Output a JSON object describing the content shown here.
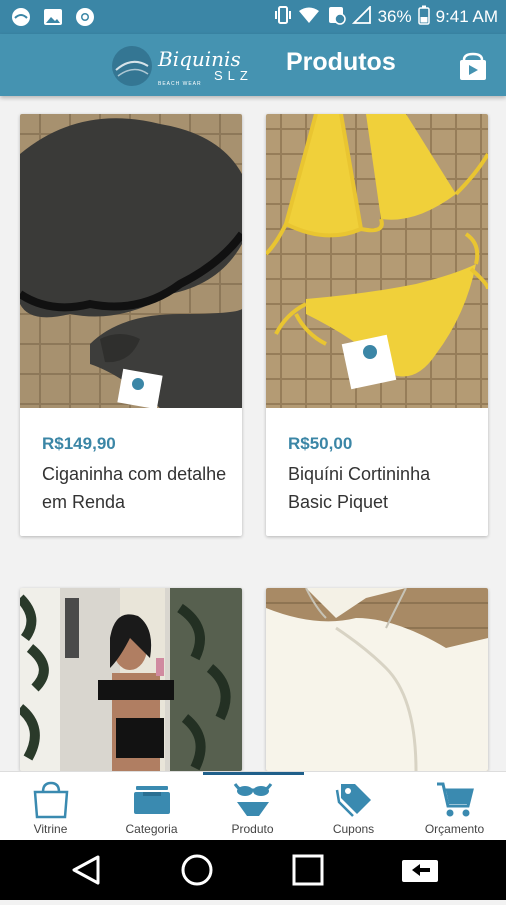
{
  "status": {
    "battery": "36%",
    "time": "9:41 AM"
  },
  "appbar": {
    "logo_text": "Biquinis SLZ",
    "logo_sub": "BEACH WEAR",
    "title": "Produtos"
  },
  "products": [
    {
      "price": "R$149,90",
      "name": "Ciganinha com detalhe em Renda"
    },
    {
      "price": "R$50,00",
      "name": "Biquíni Cortininha Basic Piquet"
    },
    {
      "price": "",
      "name": ""
    },
    {
      "price": "",
      "name": ""
    }
  ],
  "nav": {
    "items": [
      {
        "label": "Vitrine",
        "icon": "shopping-bag-icon"
      },
      {
        "label": "Categoria",
        "icon": "category-icon"
      },
      {
        "label": "Produto",
        "icon": "bikini-icon"
      },
      {
        "label": "Cupons",
        "icon": "tag-icon"
      },
      {
        "label": "Orçamento",
        "icon": "cart-icon"
      }
    ],
    "active_index": 2
  },
  "colors": {
    "statusbar": "#3b86a6",
    "appbar": "#4593b1",
    "price": "#3b86a6",
    "nav_icon": "#3a8ab0"
  }
}
